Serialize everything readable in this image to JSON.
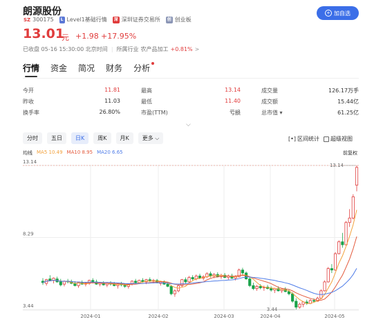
{
  "stock": {
    "name": "朗源股份",
    "market_tag": "SZ",
    "code": "300175",
    "level_tag": "L",
    "level": "Level1基础行情",
    "exchange_tag": "深",
    "exchange": "深圳证券交易所",
    "board_tag": "创",
    "board": "创业板"
  },
  "add_button": {
    "icon": "plus-circle-icon",
    "label": "加自选"
  },
  "quote": {
    "price": "13.01",
    "unit": "元",
    "change": "+1.98",
    "change_pct": "+17.95%"
  },
  "close_info": {
    "text": "已收盘 05-16 15:30:00 北京时间",
    "industry_label": "所属行业",
    "industry": "农产品加工",
    "industry_change": "+0.81%",
    "arrow": ">"
  },
  "tabs": [
    {
      "label": "行情",
      "active": true
    },
    {
      "label": "资金"
    },
    {
      "label": "简况"
    },
    {
      "label": "财务"
    },
    {
      "label": "分析",
      "dot": true
    }
  ],
  "stats": [
    [
      {
        "label": "今开",
        "value": "11.81",
        "color": "red"
      },
      {
        "label": "最高",
        "value": "13.14",
        "color": "red"
      },
      {
        "label": "成交量",
        "value": "126.17万手"
      }
    ],
    [
      {
        "label": "昨收",
        "value": "11.03"
      },
      {
        "label": "最低",
        "value": "11.40",
        "color": "red"
      },
      {
        "label": "成交额",
        "value": "15.44亿"
      }
    ],
    [
      {
        "label": "换手率",
        "value": "26.80%"
      },
      {
        "label": "市盈(TTM)",
        "value": "亏损"
      },
      {
        "label": "总市值 ▾",
        "value": "61.25亿"
      }
    ]
  ],
  "expand_icon": "chevron-down-icon",
  "periods": [
    {
      "label": "分时"
    },
    {
      "label": "五日"
    },
    {
      "label": "日K",
      "active": true
    },
    {
      "label": "周K"
    },
    {
      "label": "月K"
    },
    {
      "label": "更多"
    }
  ],
  "tools": {
    "interval_stats": "区间统计",
    "super_view": "超级视图"
  },
  "ma_legend": {
    "label": "均线",
    "ma5": "MA5 10.49",
    "ma10": "MA10 8.95",
    "ma20": "MA20 6.65",
    "adjust": "前复权"
  },
  "colors": {
    "up": "#e03c3c",
    "down": "#1aa34a",
    "accent": "#3b6ee8",
    "ma5": "#f2a13c",
    "ma10": "#e35a3c",
    "ma20": "#4f7ce8"
  },
  "chart_data": {
    "type": "candlestick",
    "y_ticks": [
      "13.14",
      "8.29",
      "3.44"
    ],
    "ylim": [
      3.44,
      13.14
    ],
    "x_ticks": [
      "2024-01",
      "2024-02",
      "2024-03",
      "2024-04",
      "2024-05"
    ],
    "max_label": "13.14",
    "min_label": "3.44",
    "candles": [
      {
        "o": 5.35,
        "h": 5.55,
        "l": 5.1,
        "c": 5.25
      },
      {
        "o": 5.2,
        "h": 5.5,
        "l": 5.05,
        "c": 5.45
      },
      {
        "o": 5.5,
        "h": 5.75,
        "l": 5.35,
        "c": 5.4
      },
      {
        "o": 5.4,
        "h": 5.6,
        "l": 5.2,
        "c": 5.55
      },
      {
        "o": 5.5,
        "h": 5.65,
        "l": 5.25,
        "c": 5.3
      },
      {
        "o": 5.3,
        "h": 5.5,
        "l": 5.0,
        "c": 5.1
      },
      {
        "o": 5.15,
        "h": 5.4,
        "l": 5.0,
        "c": 5.35
      },
      {
        "o": 5.35,
        "h": 5.5,
        "l": 5.2,
        "c": 5.3
      },
      {
        "o": 5.3,
        "h": 5.45,
        "l": 5.15,
        "c": 5.2
      },
      {
        "o": 5.2,
        "h": 5.35,
        "l": 5.0,
        "c": 5.05
      },
      {
        "o": 5.05,
        "h": 5.3,
        "l": 4.9,
        "c": 5.25
      },
      {
        "o": 5.25,
        "h": 5.4,
        "l": 5.1,
        "c": 5.15
      },
      {
        "o": 5.15,
        "h": 5.3,
        "l": 5.0,
        "c": 5.2
      },
      {
        "o": 5.2,
        "h": 5.45,
        "l": 5.1,
        "c": 5.4
      },
      {
        "o": 5.4,
        "h": 5.55,
        "l": 5.2,
        "c": 5.3
      },
      {
        "o": 5.3,
        "h": 5.45,
        "l": 5.1,
        "c": 5.15
      },
      {
        "o": 5.15,
        "h": 5.3,
        "l": 5.0,
        "c": 5.25
      },
      {
        "o": 5.25,
        "h": 5.35,
        "l": 5.05,
        "c": 5.1
      },
      {
        "o": 5.1,
        "h": 5.3,
        "l": 4.95,
        "c": 5.2
      },
      {
        "o": 5.2,
        "h": 5.35,
        "l": 5.05,
        "c": 5.15
      },
      {
        "o": 5.15,
        "h": 5.3,
        "l": 5.0,
        "c": 5.05
      },
      {
        "o": 5.05,
        "h": 5.2,
        "l": 4.85,
        "c": 5.15
      },
      {
        "o": 5.15,
        "h": 5.3,
        "l": 5.0,
        "c": 5.1
      },
      {
        "o": 5.1,
        "h": 5.2,
        "l": 4.9,
        "c": 5.0
      },
      {
        "o": 5.0,
        "h": 5.2,
        "l": 4.85,
        "c": 5.15
      },
      {
        "o": 5.15,
        "h": 5.4,
        "l": 5.05,
        "c": 5.35
      },
      {
        "o": 5.35,
        "h": 5.5,
        "l": 5.2,
        "c": 5.25
      },
      {
        "o": 5.25,
        "h": 5.45,
        "l": 5.15,
        "c": 5.4
      },
      {
        "o": 5.4,
        "h": 5.55,
        "l": 5.25,
        "c": 5.3
      },
      {
        "o": 5.3,
        "h": 5.5,
        "l": 5.15,
        "c": 5.45
      },
      {
        "o": 5.45,
        "h": 5.6,
        "l": 5.3,
        "c": 5.35
      },
      {
        "o": 5.35,
        "h": 5.5,
        "l": 5.2,
        "c": 5.4
      },
      {
        "o": 5.4,
        "h": 5.5,
        "l": 5.2,
        "c": 5.25
      },
      {
        "o": 5.2,
        "h": 5.35,
        "l": 5.05,
        "c": 5.3
      },
      {
        "o": 5.3,
        "h": 5.4,
        "l": 5.1,
        "c": 5.15
      },
      {
        "o": 5.15,
        "h": 5.3,
        "l": 4.95,
        "c": 5.0
      },
      {
        "o": 5.0,
        "h": 5.1,
        "l": 4.4,
        "c": 4.5
      },
      {
        "o": 4.5,
        "h": 4.8,
        "l": 4.3,
        "c": 4.7
      },
      {
        "o": 4.7,
        "h": 5.1,
        "l": 4.6,
        "c": 5.05
      },
      {
        "o": 5.05,
        "h": 5.5,
        "l": 4.95,
        "c": 5.45
      },
      {
        "o": 5.45,
        "h": 5.6,
        "l": 5.2,
        "c": 5.3
      },
      {
        "o": 5.3,
        "h": 5.7,
        "l": 5.2,
        "c": 5.6
      },
      {
        "o": 5.6,
        "h": 5.75,
        "l": 5.4,
        "c": 5.5
      },
      {
        "o": 5.5,
        "h": 5.8,
        "l": 5.4,
        "c": 5.7
      },
      {
        "o": 5.7,
        "h": 5.85,
        "l": 5.5,
        "c": 5.55
      },
      {
        "o": 5.55,
        "h": 5.75,
        "l": 5.4,
        "c": 5.65
      },
      {
        "o": 5.65,
        "h": 5.95,
        "l": 5.55,
        "c": 5.85
      },
      {
        "o": 5.85,
        "h": 6.0,
        "l": 5.6,
        "c": 5.7
      },
      {
        "o": 5.7,
        "h": 5.9,
        "l": 5.55,
        "c": 5.8
      },
      {
        "o": 5.8,
        "h": 5.95,
        "l": 5.6,
        "c": 5.65
      },
      {
        "o": 5.65,
        "h": 5.85,
        "l": 5.5,
        "c": 5.75
      },
      {
        "o": 5.75,
        "h": 5.9,
        "l": 5.55,
        "c": 5.6
      },
      {
        "o": 5.6,
        "h": 5.8,
        "l": 5.45,
        "c": 5.7
      },
      {
        "o": 5.7,
        "h": 5.85,
        "l": 5.5,
        "c": 5.55
      },
      {
        "o": 5.55,
        "h": 5.75,
        "l": 5.4,
        "c": 5.65
      },
      {
        "o": 5.65,
        "h": 6.2,
        "l": 5.6,
        "c": 6.1
      },
      {
        "o": 6.1,
        "h": 6.25,
        "l": 5.8,
        "c": 5.9
      },
      {
        "o": 5.9,
        "h": 6.0,
        "l": 5.45,
        "c": 5.5
      },
      {
        "o": 5.5,
        "h": 5.6,
        "l": 4.95,
        "c": 5.05
      },
      {
        "o": 5.05,
        "h": 5.25,
        "l": 4.75,
        "c": 4.85
      },
      {
        "o": 4.85,
        "h": 5.1,
        "l": 4.7,
        "c": 5.0
      },
      {
        "o": 5.0,
        "h": 5.15,
        "l": 4.8,
        "c": 4.9
      },
      {
        "o": 4.9,
        "h": 5.05,
        "l": 4.7,
        "c": 4.95
      },
      {
        "o": 4.95,
        "h": 5.1,
        "l": 4.8,
        "c": 4.85
      },
      {
        "o": 4.85,
        "h": 5.0,
        "l": 4.65,
        "c": 4.75
      },
      {
        "o": 4.75,
        "h": 4.9,
        "l": 4.55,
        "c": 4.85
      },
      {
        "o": 4.85,
        "h": 5.0,
        "l": 4.65,
        "c": 4.7
      },
      {
        "o": 4.7,
        "h": 4.85,
        "l": 4.55,
        "c": 4.8
      },
      {
        "o": 4.8,
        "h": 4.95,
        "l": 4.6,
        "c": 4.65
      },
      {
        "o": 4.65,
        "h": 4.8,
        "l": 4.4,
        "c": 4.5
      },
      {
        "o": 4.5,
        "h": 4.6,
        "l": 3.9,
        "c": 4.0
      },
      {
        "o": 4.0,
        "h": 4.2,
        "l": 3.44,
        "c": 3.6
      },
      {
        "o": 3.6,
        "h": 3.9,
        "l": 3.5,
        "c": 3.8
      },
      {
        "o": 3.8,
        "h": 4.0,
        "l": 3.6,
        "c": 3.95
      },
      {
        "o": 3.95,
        "h": 4.1,
        "l": 3.75,
        "c": 3.85
      },
      {
        "o": 3.85,
        "h": 4.15,
        "l": 3.8,
        "c": 4.05
      },
      {
        "o": 4.05,
        "h": 4.2,
        "l": 3.9,
        "c": 4.0
      },
      {
        "o": 4.0,
        "h": 4.3,
        "l": 3.95,
        "c": 4.2
      },
      {
        "o": 4.2,
        "h": 4.8,
        "l": 4.15,
        "c": 4.7
      },
      {
        "o": 4.7,
        "h": 5.4,
        "l": 4.65,
        "c": 5.3
      },
      {
        "o": 5.3,
        "h": 6.3,
        "l": 5.25,
        "c": 6.2
      },
      {
        "o": 6.2,
        "h": 6.5,
        "l": 5.9,
        "c": 6.1
      },
      {
        "o": 6.1,
        "h": 7.3,
        "l": 6.05,
        "c": 7.2
      },
      {
        "o": 7.2,
        "h": 8.1,
        "l": 7.15,
        "c": 8.0
      },
      {
        "o": 8.0,
        "h": 8.6,
        "l": 7.6,
        "c": 7.8
      },
      {
        "o": 7.8,
        "h": 9.4,
        "l": 7.75,
        "c": 9.3
      },
      {
        "o": 9.3,
        "h": 10.2,
        "l": 9.0,
        "c": 9.6
      },
      {
        "o": 9.6,
        "h": 11.2,
        "l": 9.5,
        "c": 11.03
      },
      {
        "o": 11.81,
        "h": 13.14,
        "l": 11.4,
        "c": 13.01
      }
    ]
  }
}
